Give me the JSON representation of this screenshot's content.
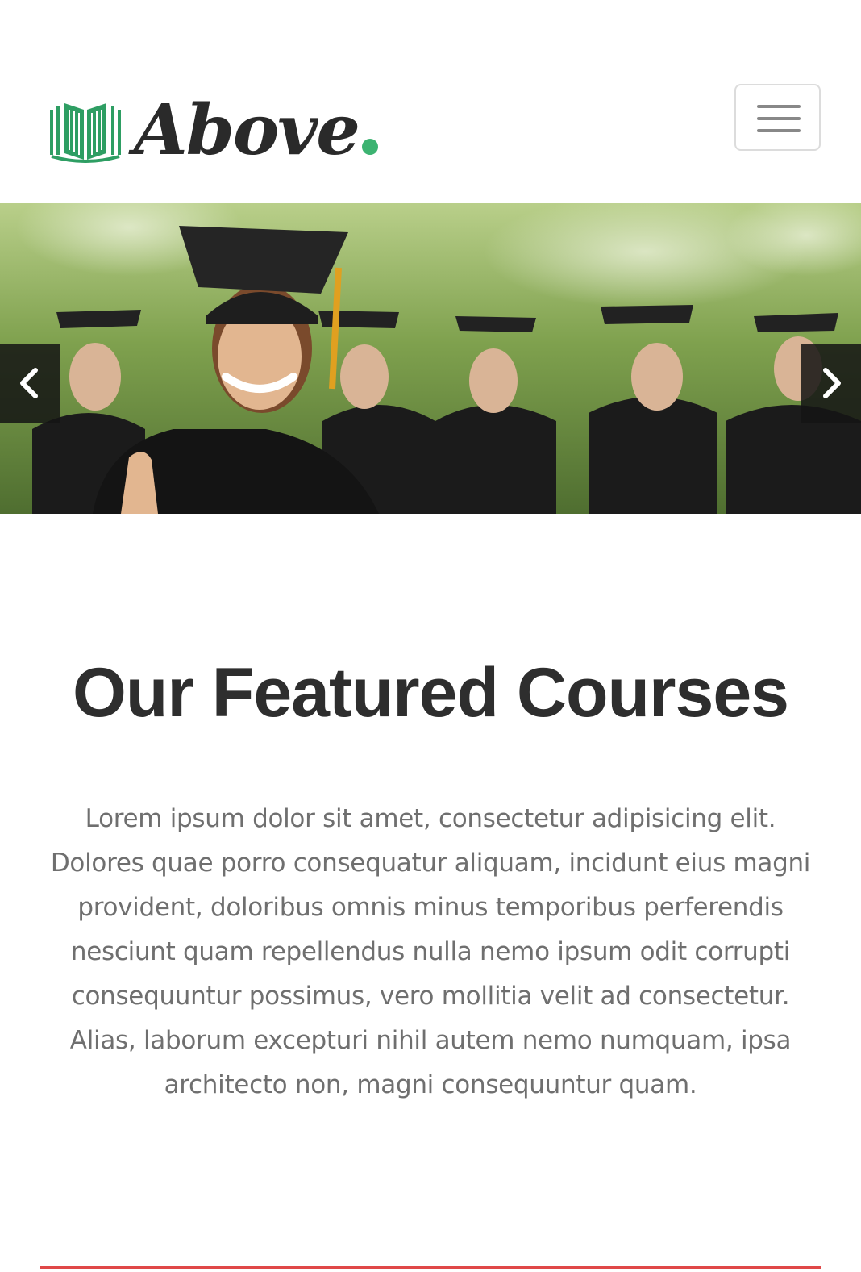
{
  "header": {
    "logo_text": "Above",
    "menu_icon": "hamburger-icon"
  },
  "hero": {
    "prev_icon": "chevron-left-icon",
    "next_icon": "chevron-right-icon"
  },
  "featured": {
    "title": "Our Featured Courses",
    "description": "Lorem ipsum dolor sit amet, consectetur adipisicing elit. Dolores quae porro consequatur aliquam, incidunt eius magni provident, doloribus omnis minus temporibus perferendis nesciunt quam repellendus nulla nemo ipsum odit corrupti consequuntur possimus, vero mollitia velit ad consectetur. Alias, laborum excepturi nihil autem nemo numquam, ipsa architecto non, magni consequuntur quam."
  },
  "colors": {
    "brand_green": "#3cb371",
    "accent_red": "#e04848",
    "heading": "#2e2e2e",
    "body_text": "#6f6f6f"
  }
}
